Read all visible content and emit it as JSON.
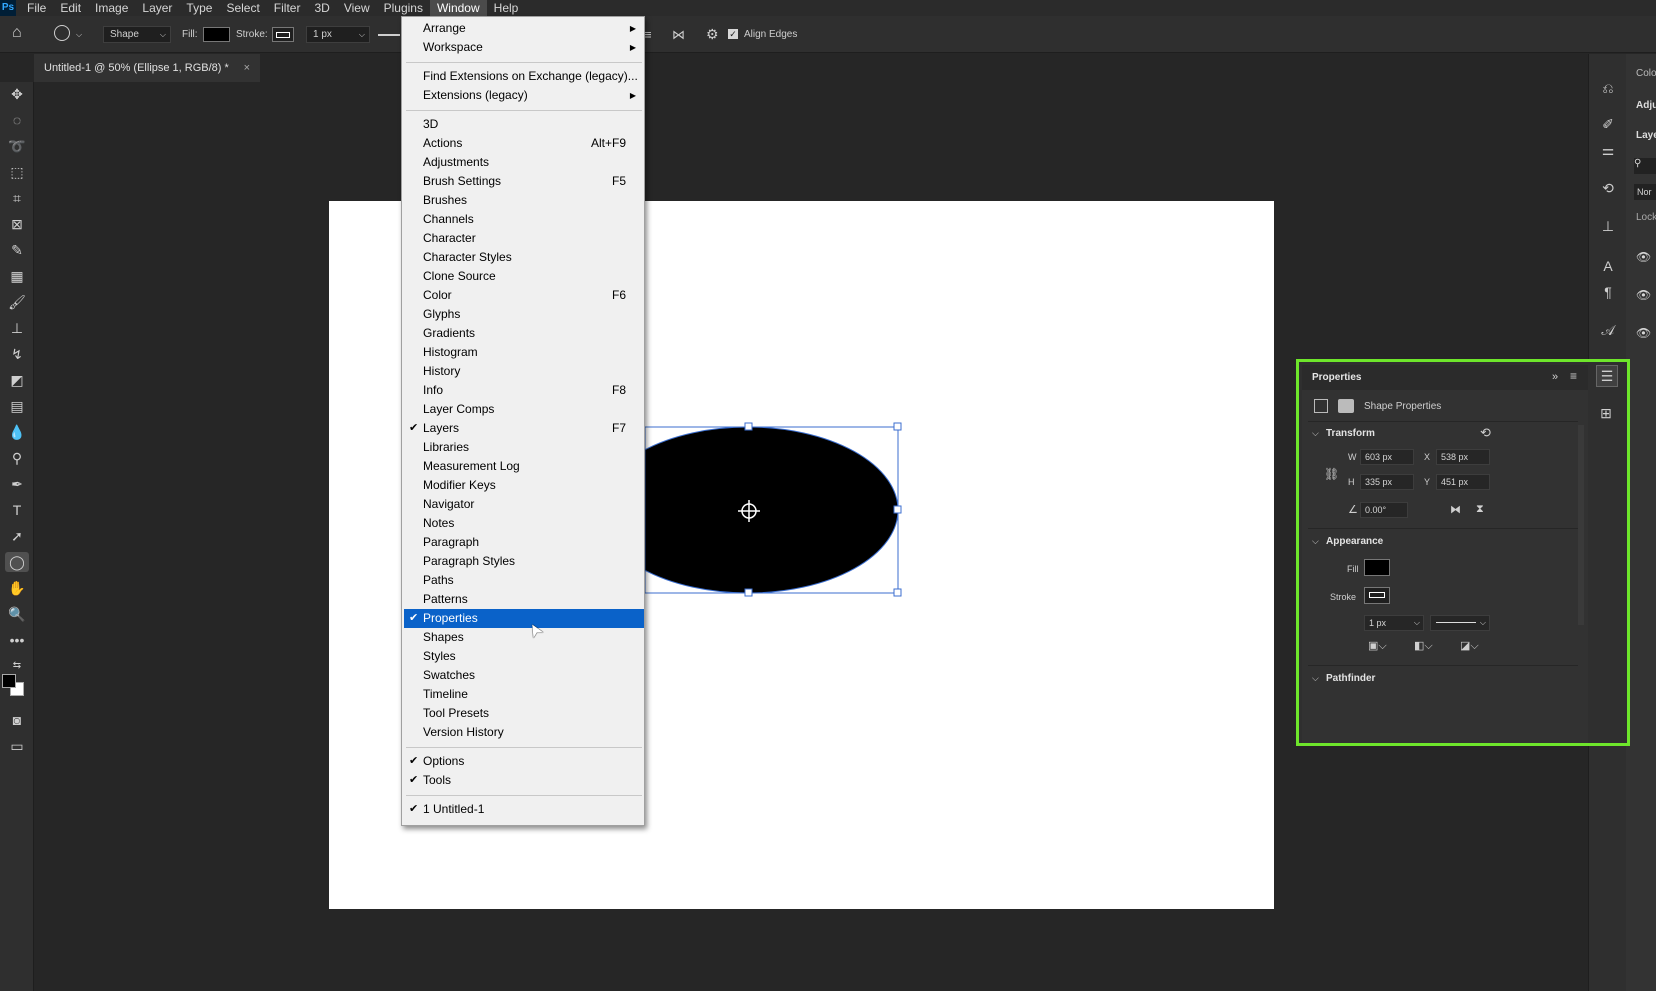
{
  "app": {
    "logo": "Ps"
  },
  "menubar": {
    "items": [
      "File",
      "Edit",
      "Image",
      "Layer",
      "Type",
      "Select",
      "Filter",
      "3D",
      "View",
      "Plugins",
      "Window",
      "Help"
    ],
    "active": "Window"
  },
  "options": {
    "shape_mode": "Shape",
    "fill_label": "Fill:",
    "stroke_label": "Stroke:",
    "stroke_width": "1 px",
    "align_edges": "Align Edges"
  },
  "document": {
    "tab_title": "Untitled-1 @ 50% (Ellipse 1, RGB/8) *",
    "close": "×"
  },
  "window_menu": {
    "groups": [
      [
        {
          "label": "Arrange",
          "submenu": true
        },
        {
          "label": "Workspace",
          "submenu": true
        }
      ],
      [
        {
          "label": "Find Extensions on Exchange (legacy)..."
        },
        {
          "label": "Extensions (legacy)",
          "submenu": true
        }
      ],
      [
        {
          "label": "3D"
        },
        {
          "label": "Actions",
          "shortcut": "Alt+F9"
        },
        {
          "label": "Adjustments"
        },
        {
          "label": "Brush Settings",
          "shortcut": "F5"
        },
        {
          "label": "Brushes"
        },
        {
          "label": "Channels"
        },
        {
          "label": "Character"
        },
        {
          "label": "Character Styles"
        },
        {
          "label": "Clone Source"
        },
        {
          "label": "Color",
          "shortcut": "F6"
        },
        {
          "label": "Glyphs"
        },
        {
          "label": "Gradients"
        },
        {
          "label": "Histogram"
        },
        {
          "label": "History"
        },
        {
          "label": "Info",
          "shortcut": "F8"
        },
        {
          "label": "Layer Comps"
        },
        {
          "label": "Layers",
          "shortcut": "F7",
          "checked": true
        },
        {
          "label": "Libraries"
        },
        {
          "label": "Measurement Log"
        },
        {
          "label": "Modifier Keys"
        },
        {
          "label": "Navigator"
        },
        {
          "label": "Notes"
        },
        {
          "label": "Paragraph"
        },
        {
          "label": "Paragraph Styles"
        },
        {
          "label": "Paths"
        },
        {
          "label": "Patterns"
        },
        {
          "label": "Properties",
          "checked": true,
          "selected": true
        },
        {
          "label": "Shapes"
        },
        {
          "label": "Styles"
        },
        {
          "label": "Swatches"
        },
        {
          "label": "Timeline"
        },
        {
          "label": "Tool Presets"
        },
        {
          "label": "Version History"
        }
      ],
      [
        {
          "label": "Options",
          "checked": true
        },
        {
          "label": "Tools",
          "checked": true
        }
      ],
      [
        {
          "label": "1 Untitled-1",
          "checked": true
        }
      ]
    ]
  },
  "properties": {
    "title": "Properties",
    "subtitle": "Shape Properties",
    "transform": {
      "heading": "Transform",
      "w_label": "W",
      "w": "603 px",
      "x_label": "X",
      "x": "538 px",
      "h_label": "H",
      "h": "335 px",
      "y_label": "Y",
      "y": "451 px",
      "angle": "0.00°"
    },
    "appearance": {
      "heading": "Appearance",
      "fill_label": "Fill",
      "stroke_label": "Stroke",
      "stroke_width": "1 px"
    },
    "pathfinder": {
      "heading": "Pathfinder"
    }
  },
  "dock2": {
    "labels": [
      "Colo",
      "Adju",
      "Laye",
      "Nor",
      "Lock"
    ]
  },
  "colors": {
    "highlight": "#6ee62b",
    "menu_selection": "#0a62c9",
    "ellipse_fill": "#000000",
    "selection_box": "#3b6ecf"
  }
}
